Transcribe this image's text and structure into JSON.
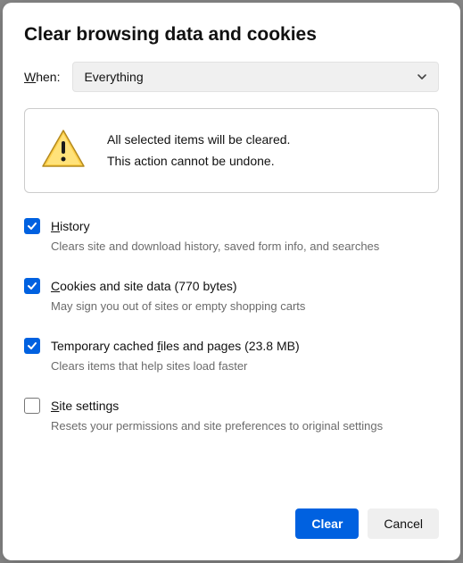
{
  "title": "Clear browsing data and cookies",
  "when": {
    "label_pre": "W",
    "label_mid": "hen:",
    "selected": "Everything"
  },
  "warning": {
    "line1": "All selected items will be cleared.",
    "line2": "This action cannot be undone."
  },
  "options": [
    {
      "checked": true,
      "accel": "H",
      "rest": "istory",
      "size": "",
      "desc": "Clears site and download history, saved form info, and searches"
    },
    {
      "checked": true,
      "accel": "C",
      "rest": "ookies and site data",
      "size": " (770 bytes)",
      "desc": "May sign you out of sites or empty shopping carts"
    },
    {
      "checked": true,
      "accel": "",
      "rest": "Temporary cached ",
      "accel2": "f",
      "rest2": "iles and pages",
      "size": " (23.8 MB)",
      "desc": "Clears items that help sites load faster"
    },
    {
      "checked": false,
      "accel": "S",
      "rest": "ite settings",
      "size": "",
      "desc": "Resets your permissions and site preferences to original settings"
    }
  ],
  "buttons": {
    "clear": "Clear",
    "cancel": "Cancel"
  }
}
